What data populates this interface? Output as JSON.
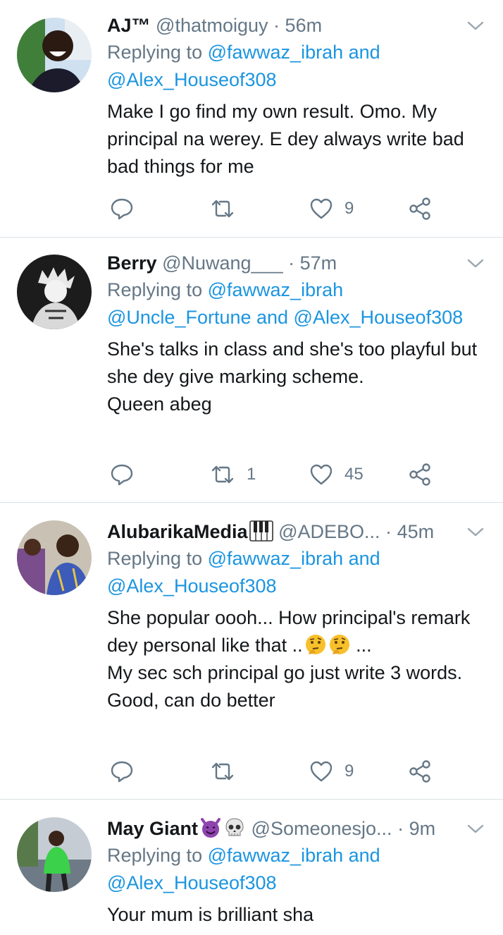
{
  "tweets": [
    {
      "name": "AJ™",
      "handle": "@thatmoiguy",
      "dot": "·",
      "time": "56m",
      "reply_prefix": "Replying to",
      "reply_links": "@fawwaz_ibrah and @Alex_Houseof308",
      "text": "Make I go find my own result. Omo. My principal na werey. E dey always write bad bad things for me",
      "replies": "",
      "retweets": "",
      "likes": "9"
    },
    {
      "name": "Berry",
      "handle": "@Nuwang___",
      "dot": "·",
      "time": "57m",
      "reply_prefix": "Replying to",
      "reply_links": "@fawwaz_ibrah @Uncle_Fortune and @Alex_Houseof308",
      "text": "She's talks in class and she's too playful but she dey give marking scheme.\nQueen abeg",
      "replies": "",
      "retweets": "1",
      "likes": "45"
    },
    {
      "name": "AlubarikaMedia",
      "name_emoji": "piano-keys",
      "handle": "@ADEBO...",
      "dot": "·",
      "time": "45m",
      "reply_prefix": "Replying to",
      "reply_links": "@fawwaz_ibrah and @Alex_Houseof308",
      "text_line1": "She popular oooh... How principal's remark dey personal like that ..",
      "text_emoji": "thinking-face",
      "text_line1_end": " ...",
      "text_rest": "My sec sch principal go just write 3 words.\nGood, can do better",
      "replies": "",
      "retweets": "",
      "likes": "9"
    },
    {
      "name": "May Giant",
      "name_emojis": [
        "smiling-devil",
        "skull"
      ],
      "handle": "@Someonesjo...",
      "dot": "·",
      "time": "9m",
      "reply_prefix": "Replying to",
      "reply_links": "@fawwaz_ibrah and @Alex_Houseof308",
      "text": "Your mum is brilliant sha"
    }
  ],
  "icons": {
    "reply": "reply-icon",
    "retweet": "retweet-icon",
    "like": "heart-icon",
    "share": "share-icon",
    "caret": "chevron-down-icon"
  },
  "colors": {
    "link": "#1b95e0",
    "secondary": "#657786",
    "text": "#14171a",
    "divider": "#dbe1e6"
  }
}
